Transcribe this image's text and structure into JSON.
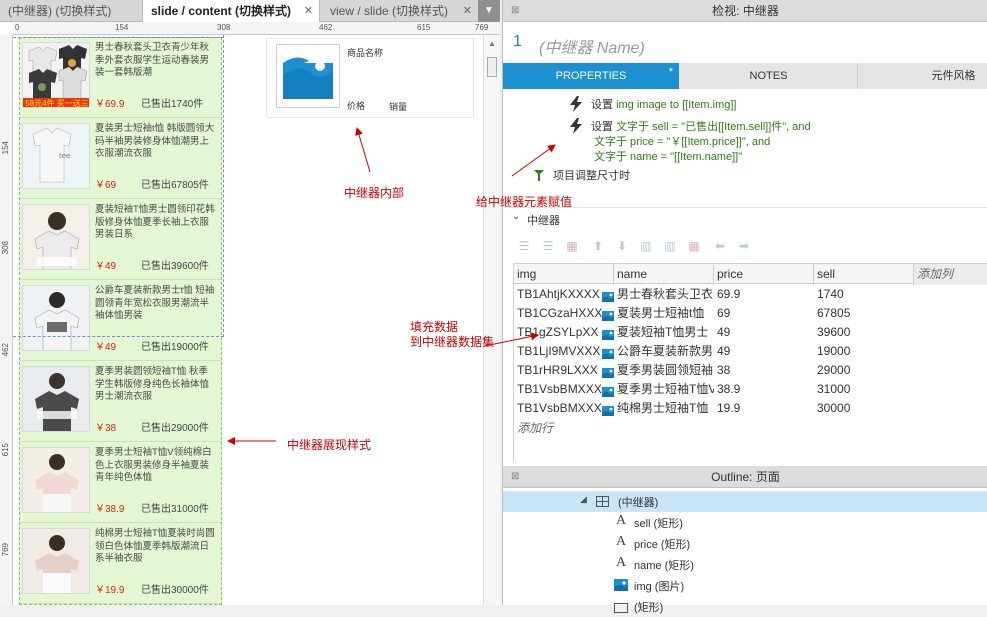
{
  "tabs": [
    {
      "label": "(中继器) (切换样式)",
      "active": false
    },
    {
      "label": "slide / content (切换样式)",
      "active": true
    },
    {
      "label": "view / slide (切换样式)",
      "active": false
    }
  ],
  "ruler": {
    "h": [
      "0",
      "154",
      "308",
      "462",
      "615",
      "769"
    ],
    "v": [
      "154",
      "308",
      "462",
      "615",
      "769"
    ]
  },
  "items": [
    {
      "name": "男士春秋套头卫衣青少年秋季外套衣服学生运动春装男装一套韩版潮",
      "price": "￥69.9",
      "sell": "已售出1740件",
      "banner": "58元4件 买一送三"
    },
    {
      "name": "夏装男士短袖t恤 韩版圆领大码半袖男装修身体恤潮男上衣服潮流衣服",
      "price": "￥69",
      "sell": "已售出67805件"
    },
    {
      "name": "夏装短袖T恤男士圆领印花韩版修身体恤夏季长袖上衣服男装日系",
      "price": "￥49",
      "sell": "已售出39600件"
    },
    {
      "name": "公爵车夏装新款男士t恤 短袖圆领青年宽松衣服男潮流半袖体恤男装",
      "price": "￥49",
      "sell": "已售出19000件"
    },
    {
      "name": "夏季男装圆领短袖T恤 秋季学生韩版修身纯色长袖体恤男士潮流衣服",
      "price": "￥38",
      "sell": "已售出29000件"
    },
    {
      "name": "夏季男士短袖T恤V领纯棉白色上衣服男装修身半袖夏装青年纯色体恤",
      "price": "￥38.9",
      "sell": "已售出31000件"
    },
    {
      "name": "纯棉男士短袖T恤夏装时尚圆领白色体恤夏季韩版潮流日系半袖衣服",
      "price": "￥19.9",
      "sell": "已售出30000件"
    }
  ],
  "template": {
    "name": "商品名称",
    "price": "价格",
    "sell": "销量"
  },
  "annotations": {
    "inside": "中继器内部",
    "style": "中继器展现样式",
    "assign": "给中继器元素赋值",
    "fill_line1": "填充数据",
    "fill_line2": "到中继器数据集"
  },
  "inspector": {
    "title": "检视: 中继器",
    "number": "1",
    "name_placeholder": "(中继器 Name)",
    "tabs": [
      "PROPERTIES",
      "NOTES",
      "元件风格"
    ],
    "properties_marker": "*"
  },
  "interactions": {
    "action1": {
      "prefix": "设置 ",
      "value": "img image to [[Item.img]]"
    },
    "action2": [
      {
        "prefix": "设置 ",
        "value": "文字于 sell = \"已售出[[Item.sell]]件\", and"
      },
      {
        "prefix": "",
        "value": "文字于 price = \"￥[[Item.price]]\", and"
      },
      {
        "prefix": "",
        "value": "文字于 name = \"[[Item.name]]\""
      }
    ],
    "resize": "项目调整尺寸时"
  },
  "repeater_section": "中继器",
  "dataset": {
    "columns": [
      "img",
      "name",
      "price",
      "sell",
      "添加列"
    ],
    "rows": [
      {
        "img": "TB1AhtjKXXXX",
        "name": "男士春秋套头卫衣",
        "price": "69.9",
        "sell": "1740"
      },
      {
        "img": "TB1CGzaHXXX",
        "name": "夏装男士短袖t恤",
        "price": "69",
        "sell": "67805"
      },
      {
        "img": "TB1gZSYLpXX",
        "name": "夏装短袖T恤男士",
        "price": "49",
        "sell": "39600"
      },
      {
        "img": "TB1LjI9MVXXX",
        "name": "公爵车夏装新款男",
        "price": "49",
        "sell": "19000"
      },
      {
        "img": "TB1rHR9LXXX",
        "name": "夏季男装圆领短袖",
        "price": "38",
        "sell": "29000"
      },
      {
        "img": "TB1VsbBMXXX",
        "name": "夏季男士短袖T恤V",
        "price": "38.9",
        "sell": "31000"
      },
      {
        "img": "TB1VsbBMXXX",
        "name": "纯棉男士短袖T恤",
        "price": "19.9",
        "sell": "30000"
      }
    ],
    "add_row": "添加行"
  },
  "outline": {
    "title": "Outline: 页面",
    "items": [
      {
        "label": "(中继器)",
        "kind": "repeater"
      },
      {
        "label": "sell (矩形)",
        "kind": "text"
      },
      {
        "label": "price (矩形)",
        "kind": "text"
      },
      {
        "label": "name (矩形)",
        "kind": "text"
      },
      {
        "label": "img (图片)",
        "kind": "image"
      },
      {
        "label": "(矩形)",
        "kind": "rect"
      }
    ]
  },
  "colors": {
    "accent": "#1d90d2",
    "annotation": "#cc0000",
    "repeater_bg": "#e3f7d2",
    "price": "#e02020"
  }
}
